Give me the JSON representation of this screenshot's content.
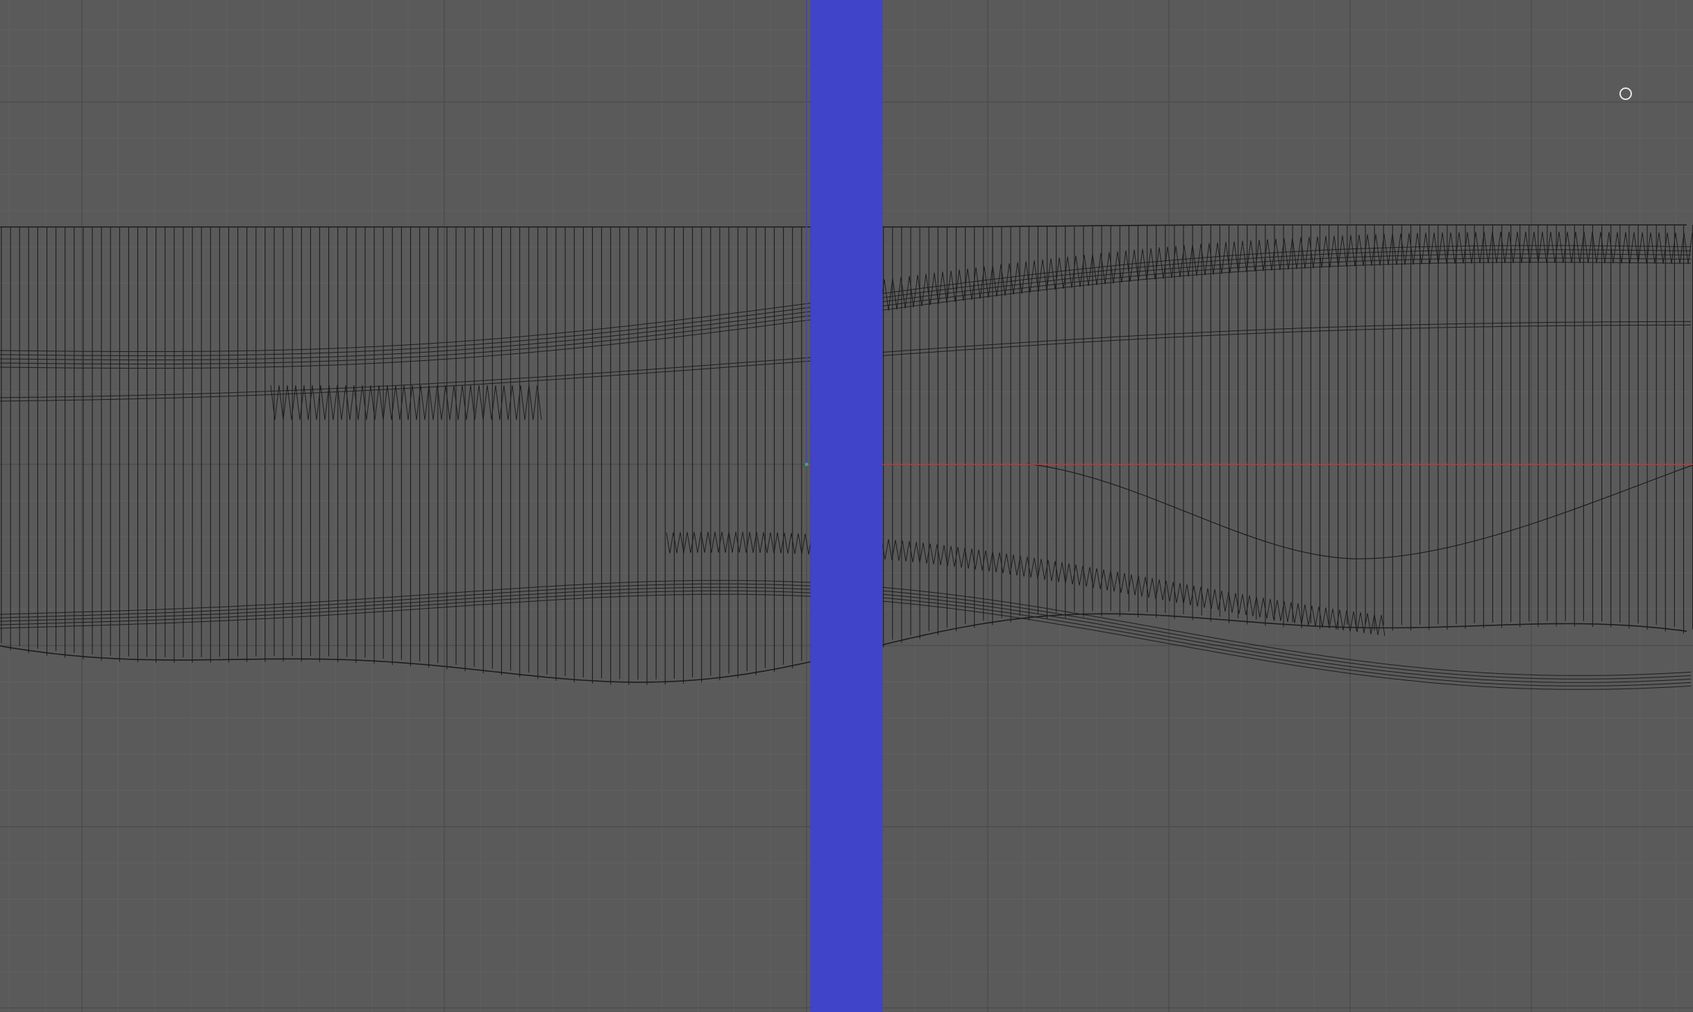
{
  "app": {
    "view_type": "3D viewport",
    "shading": "wireframe"
  },
  "colors": {
    "background": "#5a5a5a",
    "grid_minor": "#616161",
    "grid_major": "#4d4d4d",
    "wire": "#1c1c1c",
    "x_axis": "#c63a3a",
    "z_axis": "#3f44c9",
    "origin": "#2fa5a0",
    "gizmo": "#e8e8e8"
  },
  "icons": {
    "navigation_gizmo": "circle-outline-icon",
    "axis_indicator": "axis-line-icon",
    "origin_marker": "origin-dot-icon"
  }
}
